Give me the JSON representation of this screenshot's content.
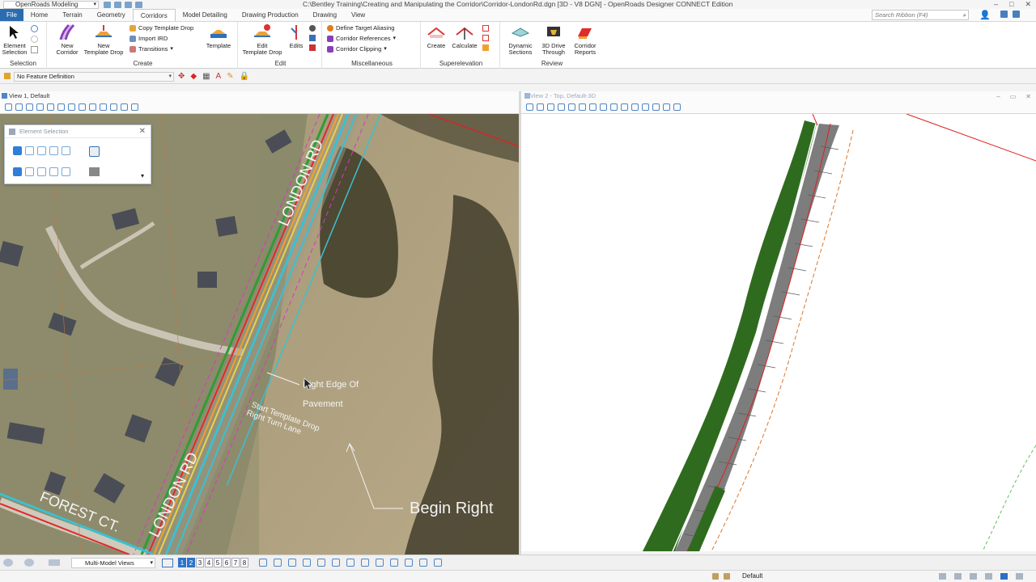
{
  "window": {
    "workspace": "OpenRoads Modeling",
    "title": "C:\\Bentley Training\\Creating and Manipulating the Corridor\\Corridor-LondonRd.dgn [3D - V8 DGN] - OpenRoads Designer CONNECT Edition"
  },
  "tabs": [
    "File",
    "Home",
    "Terrain",
    "Geometry",
    "Corridors",
    "Model Detailing",
    "Drawing Production",
    "Drawing",
    "View"
  ],
  "active_tab": "Corridors",
  "search": {
    "placeholder": "Search Ribbon (F4)"
  },
  "ribbon": {
    "selection": {
      "label": "Selection",
      "element_selection": "Element\nSelection"
    },
    "create": {
      "label": "Create",
      "new_corridor": "New\nCorridor",
      "new_template_drop": "New\nTemplate Drop",
      "copy_template_drop": "Copy Template Drop",
      "import_ird": "Import IRD",
      "transitions": "Transitions",
      "template": "Template"
    },
    "edit": {
      "label": "Edit",
      "edit_template_drop": "Edit\nTemplate Drop",
      "edits": "Edits"
    },
    "misc": {
      "label": "Miscellaneous",
      "define_target_aliasing": "Define Target Aliasing",
      "corridor_references": "Corridor References",
      "corridor_clipping": "Corridor Clipping"
    },
    "superelevation": {
      "label": "Superelevation",
      "create": "Create",
      "calculate": "Calculate"
    },
    "review": {
      "label": "Review",
      "dynamic_sections": "Dynamic\nSections",
      "drive_through": "3D Drive\nThrough",
      "corridor_reports": "Corridor\nReports"
    }
  },
  "feature_definition": "No Feature Definition",
  "view1": {
    "title": "View 1, Default",
    "annotations": {
      "london_rd_top": "LONDON RD",
      "london_rd_bottom": "LONDON RD",
      "forest_ct": "FOREST CT.",
      "right_edge_line1": "Right Edge Of",
      "right_edge_line2": "Pavement",
      "start_drop_line1": "Start Template Drop",
      "start_drop_line2": "Right Turn Lane",
      "begin_right": "Begin Right"
    }
  },
  "view2": {
    "title": "View 2 - Top, Default-3D"
  },
  "element_selection_dialog": {
    "title": "Element Selection"
  },
  "bottom_toolbar": {
    "views_dropdown": "Multi-Model Views",
    "view_numbers": [
      "1",
      "2",
      "3",
      "4",
      "5",
      "6",
      "7",
      "8"
    ],
    "active_views": [
      "1",
      "2"
    ]
  },
  "status": {
    "level": "Default"
  },
  "colors": {
    "accent": "#2b6cb0",
    "corridor_green": "#2f6b1e",
    "roadway_grey": "#7d7d7d",
    "edge_red": "#e02020",
    "edge_orange": "#d9772b"
  }
}
